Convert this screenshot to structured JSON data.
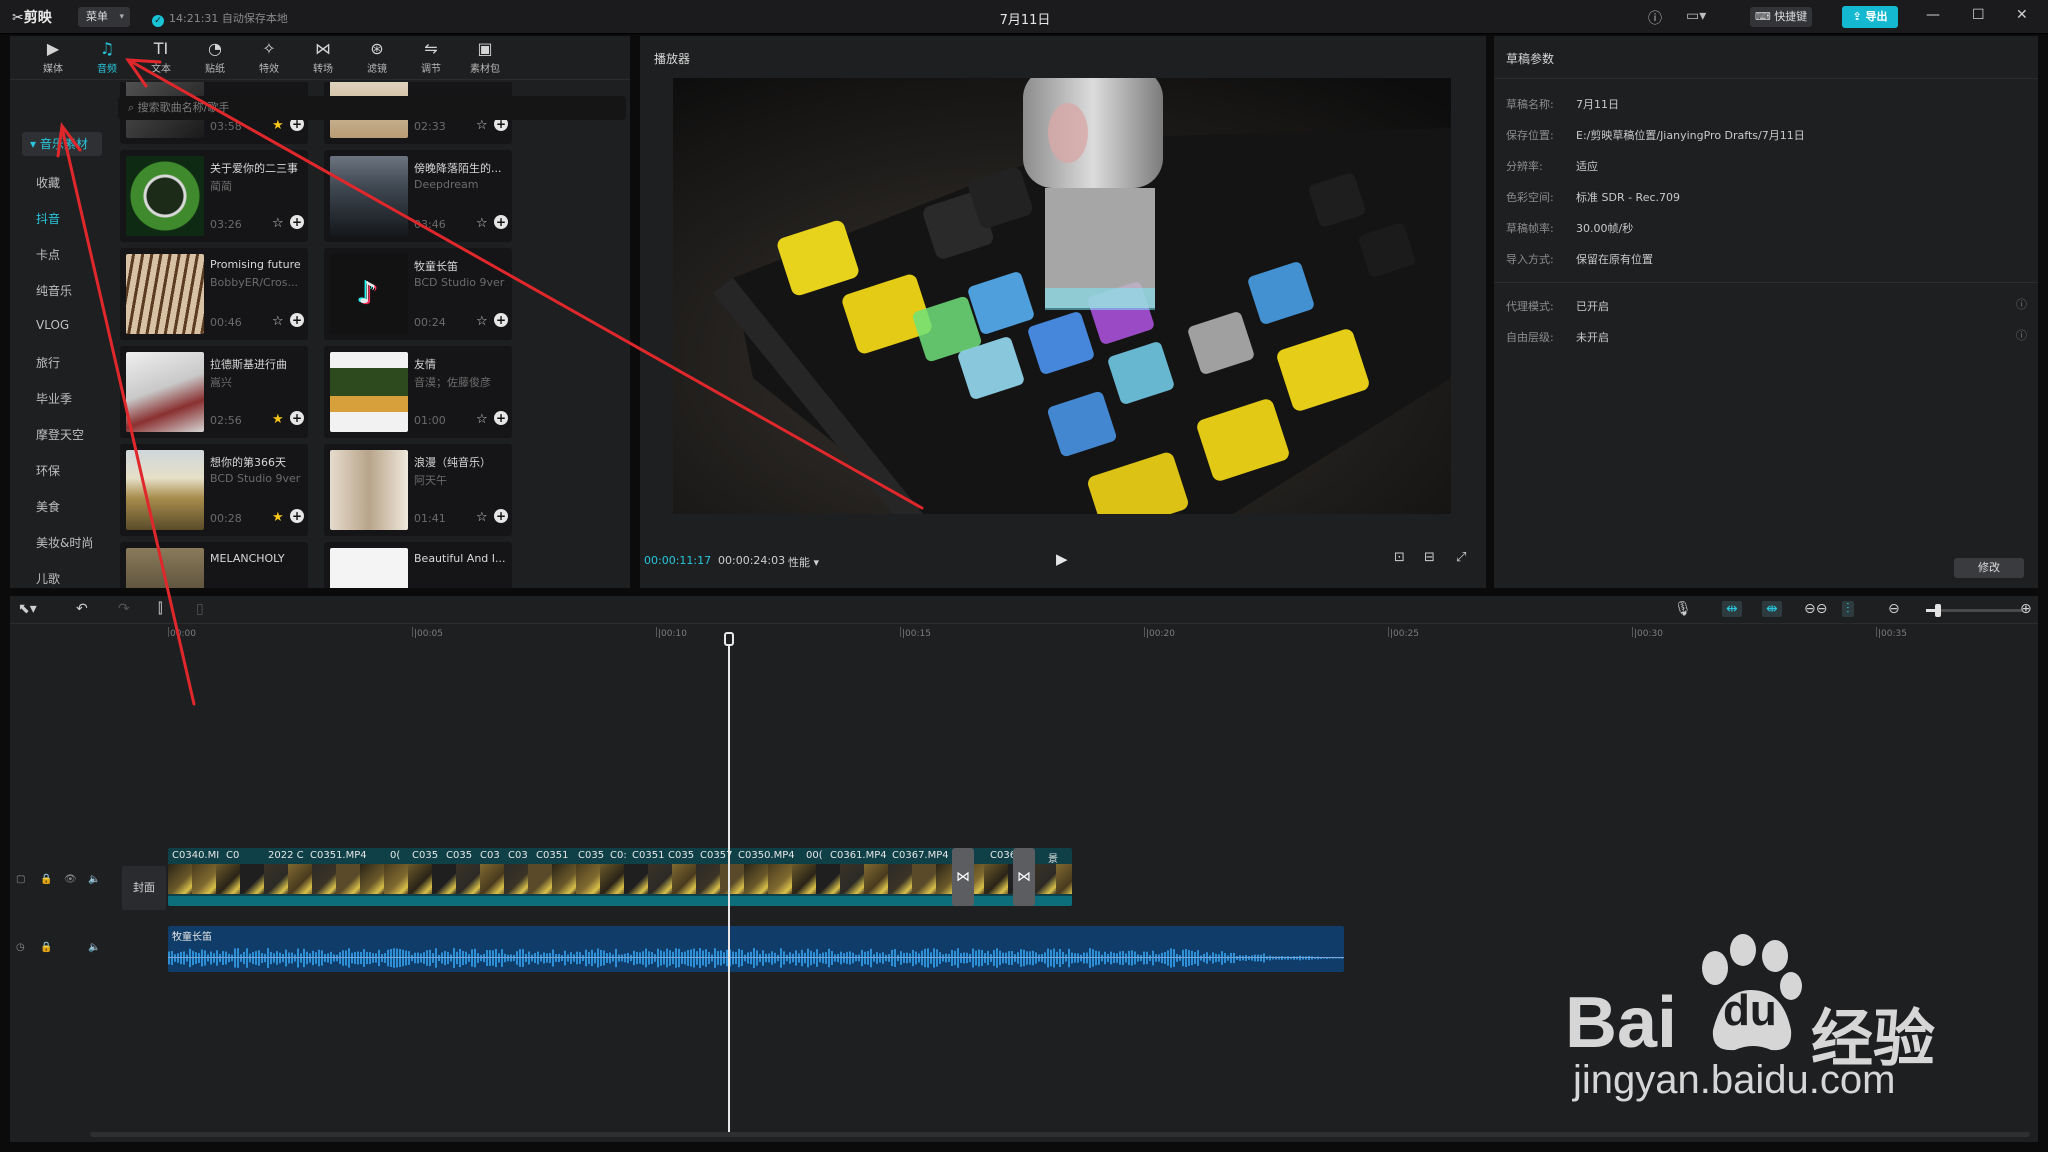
{
  "titlebar": {
    "logo": "剪映",
    "menu": "菜单",
    "autosave": "14:21:31 自动保存本地",
    "title": "7月11日",
    "shortcut": "快捷键",
    "export": "导出"
  },
  "toolbar": {
    "tabs": [
      {
        "label": "媒体",
        "icon": "media-icon"
      },
      {
        "label": "音频",
        "icon": "audio-icon"
      },
      {
        "label": "文本",
        "icon": "text-icon"
      },
      {
        "label": "贴纸",
        "icon": "sticker-icon"
      },
      {
        "label": "特效",
        "icon": "effects-icon"
      },
      {
        "label": "转场",
        "icon": "transition-icon"
      },
      {
        "label": "滤镜",
        "icon": "filter-icon"
      },
      {
        "label": "调节",
        "icon": "adjust-icon"
      },
      {
        "label": "素材包",
        "icon": "package-icon"
      }
    ]
  },
  "categories": {
    "selected": "音乐素材",
    "items": [
      "收藏",
      "抖音",
      "卡点",
      "纯音乐",
      "VLOG",
      "旅行",
      "毕业季",
      "摩登天空",
      "环保",
      "美食",
      "美妆&时尚",
      "儿歌",
      "萌宠"
    ]
  },
  "search": {
    "placeholder": "搜索歌曲名称/歌手"
  },
  "tracks": [
    {
      "title": "",
      "artist": "",
      "duration": "03:58",
      "fav": true
    },
    {
      "title": "",
      "artist": "",
      "duration": "02:33",
      "fav": false
    },
    {
      "title": "关于爱你的二三事",
      "artist": "蔺蔺",
      "duration": "03:26",
      "fav": false
    },
    {
      "title": "傍晚降落陌生的...",
      "artist": "Deepdream",
      "duration": "03:46",
      "fav": false
    },
    {
      "title": "Promising future",
      "artist": "BobbyER/Cros...",
      "duration": "00:46",
      "fav": false
    },
    {
      "title": "牧童长笛",
      "artist": "BCD Studio 9ver",
      "duration": "00:24",
      "fav": false
    },
    {
      "title": "拉德斯基进行曲",
      "artist": "嵩兴",
      "duration": "02:56",
      "fav": true
    },
    {
      "title": "友情",
      "artist": "音漠；佐藤俊彦",
      "duration": "01:00",
      "fav": false
    },
    {
      "title": "想你的第366天",
      "artist": "BCD Studio 9ver",
      "duration": "00:28",
      "fav": true
    },
    {
      "title": "浪漫（纯音乐）",
      "artist": "阿天午",
      "duration": "01:41",
      "fav": false
    },
    {
      "title": "MELANCHOLY",
      "artist": "",
      "duration": "",
      "fav": false
    },
    {
      "title": "Beautiful And I...",
      "artist": "",
      "duration": "",
      "fav": false
    }
  ],
  "player": {
    "header": "播放器",
    "current_time": "00:00:11:17",
    "total_time": "00:00:24:03",
    "performance": "性能"
  },
  "properties": {
    "header": "草稿参数",
    "rows": [
      {
        "key": "草稿名称:",
        "value": "7月11日"
      },
      {
        "key": "保存位置:",
        "value": "E:/剪映草稿位置/JianyingPro Drafts/7月11日"
      },
      {
        "key": "分辨率:",
        "value": "适应"
      },
      {
        "key": "色彩空间:",
        "value": "标准 SDR - Rec.709"
      },
      {
        "key": "草稿帧率:",
        "value": "30.00帧/秒"
      },
      {
        "key": "导入方式:",
        "value": "保留在原有位置"
      }
    ],
    "rows2": [
      {
        "key": "代理模式:",
        "value": "已开启"
      },
      {
        "key": "自由层级:",
        "value": "未开启"
      }
    ],
    "modify": "修改"
  },
  "timeline": {
    "ticks": [
      "00:00",
      "|00:05",
      "|00:10",
      "|00:15",
      "|00:20",
      "|00:25",
      "|00:30",
      "|00:35"
    ],
    "cover": "封面",
    "clips": [
      "C0340.MI",
      "C0",
      "2022 C",
      "C0351.MP4",
      "0(",
      "C035",
      "C035",
      "C03",
      "C03",
      "C0351",
      "C035",
      "C0:",
      "C0351",
      "C035",
      "C0357",
      "C0350.MP4",
      "00(",
      "C0361.MP4",
      "C0367.MP4",
      "C0367",
      "景"
    ],
    "audio_label": "牧童长笛",
    "zoom": 0.12
  },
  "watermark": {
    "text1": "Bai",
    "text2": "du",
    "text3": "经验",
    "url": "jingyan.baidu.com"
  }
}
